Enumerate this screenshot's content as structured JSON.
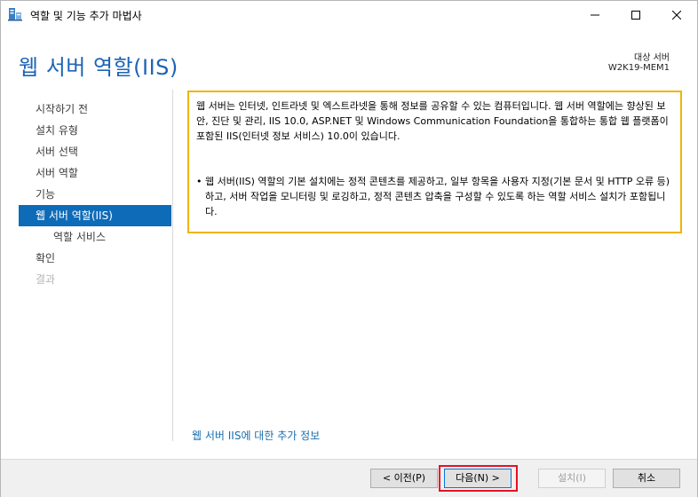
{
  "window": {
    "title": "역할 및 기능 추가 마법사"
  },
  "header": {
    "page_title": "웹 서버 역할(IIS)",
    "destination_label": "대상 서버",
    "destination_server": "W2K19-MEM1"
  },
  "nav": {
    "items": [
      {
        "label": "시작하기 전",
        "state": "normal"
      },
      {
        "label": "설치 유형",
        "state": "normal"
      },
      {
        "label": "서버 선택",
        "state": "normal"
      },
      {
        "label": "서버 역할",
        "state": "normal"
      },
      {
        "label": "기능",
        "state": "normal"
      },
      {
        "label": "웹 서버 역할(IIS)",
        "state": "active"
      },
      {
        "label": "역할 서비스",
        "state": "sub"
      },
      {
        "label": "확인",
        "state": "normal"
      },
      {
        "label": "결과",
        "state": "disabled"
      }
    ]
  },
  "content": {
    "description": "웹 서버는 인터넷, 인트라넷 및 엑스트라넷을 통해 정보를 공유할 수 있는 컴퓨터입니다. 웹 서버 역할에는 향상된 보안, 진단 및 관리, IIS 10.0, ASP.NET 및 Windows Communication Foundation을 통합하는 통합 웹 플랫폼이 포함된 IIS(인터넷 정보 서비스) 10.0이 있습니다.",
    "bullet_glyph": "•",
    "bullet": "웹 서버(IIS) 역할의 기본 설치에는 정적 콘텐츠를 제공하고, 일부 항목을 사용자 지정(기본 문서 및 HTTP 오류 등)하고, 서버 작업을 모니터링 및 로깅하고, 정적 콘텐츠 압축을 구성할 수 있도록 하는 역할 서비스 설치가 포함됩니다.",
    "more_info_link": "웹 서버 IIS에 대한 추가 정보"
  },
  "footer": {
    "prev_label": "< 이전(P)",
    "next_label": "다음(N) >",
    "install_label": "설치(I)",
    "cancel_label": "취소"
  },
  "colors": {
    "accent": "#0e6bb8",
    "title": "#1e64b4",
    "highlight_box": "#f0b400",
    "highlight_button": "#e81123"
  },
  "icons": [
    "server-manager-icon",
    "minimize-icon",
    "maximize-icon",
    "close-icon"
  ]
}
